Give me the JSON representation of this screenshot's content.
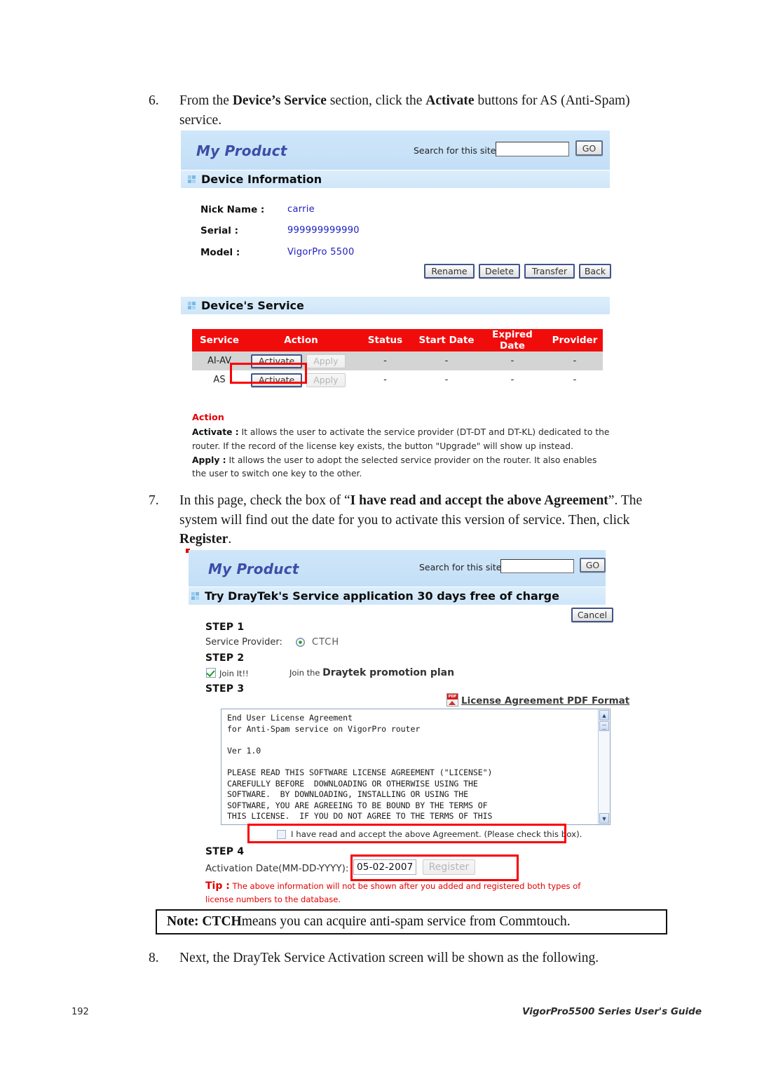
{
  "page": {
    "number": "192",
    "guide": "VigorPro5500 Series User's Guide"
  },
  "steps": {
    "step6": {
      "number": "6.",
      "text_before_1": "From the ",
      "bold_1": "Device’s Service",
      "text_mid_1": " section, click the ",
      "bold_2": "Activate",
      "text_after": " buttons for AS (Anti-Spam) service."
    },
    "step7": {
      "number": "7.",
      "text_1": "In this page, check the box of “",
      "bold_1": "I have read and accept the above Agreement",
      "text_2": "”. The system will find out the date for you to activate this version of service. Then, click ",
      "bold_2": "Register",
      "text_3": "."
    },
    "step8": {
      "number": "8.",
      "text": "Next, the DrayTek Service Activation screen will be shown as the following."
    }
  },
  "note": {
    "bold": "Note: CTCH",
    "text": " means you can acquire anti-spam service from Commtouch."
  },
  "shot1": {
    "brand": "My Product",
    "search_label": "Search for this site",
    "search_value": "",
    "search_placeholder": "",
    "go_label": "GO",
    "section_device_info": "Device Information",
    "fields": [
      {
        "label": "Nick Name :",
        "value": "carrie"
      },
      {
        "label": "Serial :",
        "value": "999999999990"
      },
      {
        "label": "Model :",
        "value": "VigorPro 5500"
      }
    ],
    "buttons": [
      "Rename",
      "Delete",
      "Transfer",
      "Back"
    ],
    "section_device_service": "Device's Service",
    "table": {
      "columns": [
        "Service",
        "Action",
        "Status",
        "Start Date",
        "Expired Date",
        "Provider"
      ],
      "rows": [
        {
          "service": "AI-AV",
          "action_primary": "Activate",
          "action_secondary": "Apply",
          "status": "-",
          "start_date": "-",
          "expired_date": "-",
          "provider": "-"
        },
        {
          "service": "AS",
          "action_primary": "Activate",
          "action_secondary": "Apply",
          "status": "-",
          "start_date": "-",
          "expired_date": "-",
          "provider": "-"
        }
      ]
    },
    "action_note": {
      "heading": "Action",
      "activate_label": "Activate :",
      "activate_text": " It allows the user to activate the service provider (DT-DT and DT-KL) dedicated to the router. If the record of the license key exists, the button \"Upgrade\" will show up instead.",
      "apply_label": "Apply :",
      "apply_text": " It allows the user to adopt the selected service provider on the router. It also enables the user to switch one key to the other."
    }
  },
  "shot2": {
    "brand": "My Product",
    "search_label": "Search for this site",
    "search_value": "",
    "go_label": "GO",
    "section_title": "Try DrayTek's Service application 30 days free of charge",
    "cancel_label": "Cancel",
    "step1_title": "STEP 1",
    "service_provider_label": "Service Provider:",
    "service_provider_value": "CTCH",
    "step2_title": "STEP 2",
    "join_checkbox_label": "Join It!!",
    "join_text_light": "Join the ",
    "join_text_bold": "Draytek promotion plan",
    "step3_title": "STEP 3",
    "pdf_link_label": "License Agreement PDF Format",
    "pdf_icon_label": "PDF",
    "license_text": "End User License Agreement\nfor Anti-Spam service on VigorPro router\n\nVer 1.0\n\nPLEASE READ THIS SOFTWARE LICENSE AGREEMENT (\"LICENSE\")\nCAREFULLY BEFORE  DOWNLOADING OR OTHERWISE USING THE\nSOFTWARE.  BY DOWNLOADING, INSTALLING OR USING THE\nSOFTWARE, YOU ARE AGREEING TO BE BOUND BY THE TERMS OF\nTHIS LICENSE.  IF YOU DO NOT AGREE TO THE TERMS OF THIS",
    "agree_label": "I have read and accept the above Agreement. (Please check this box).",
    "step4_title": "STEP 4",
    "activation_date_label": "Activation Date(MM-DD-YYYY):",
    "activation_date_value": "05-02-2007",
    "register_label": "Register",
    "tip_word": "Tip :",
    "tip_text": " The above information will not be shown after you added and registered both types of license numbers to the database."
  },
  "colors": {
    "header_blue": "#c9e3f7",
    "table_header_red": "#f10c0c",
    "brand_blue": "#3b4ea8",
    "link_blue": "#2020c0",
    "highlight_red": "#fb0000",
    "tip_red": "#e30000"
  }
}
